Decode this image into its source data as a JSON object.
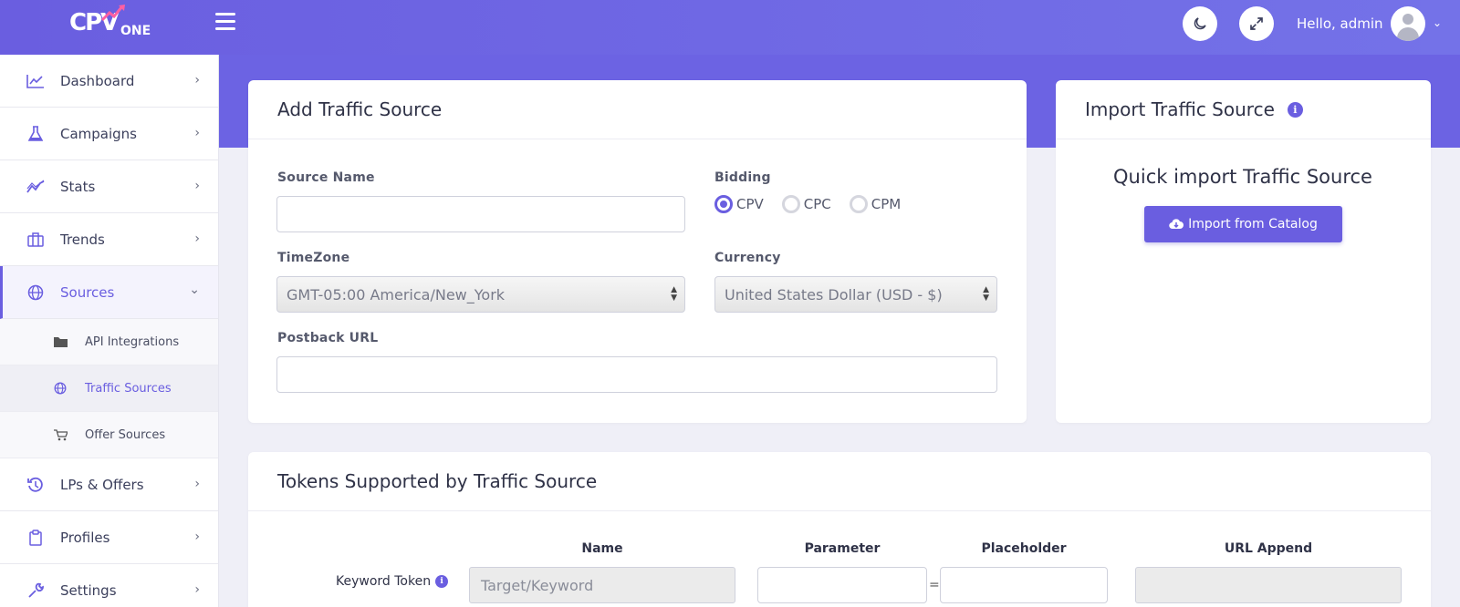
{
  "app": {
    "logo_text": "CPV",
    "logo_sub": "ONE",
    "greeting": "Hello, admin",
    "accent": "#6a5ee0"
  },
  "topbar_icons": [
    "hamburger-icon",
    "moon-icon",
    "expand-icon",
    "user-icon",
    "chevron-down-icon"
  ],
  "sidebar": {
    "items": [
      {
        "label": "Dashboard",
        "icon": "chart-line-icon"
      },
      {
        "label": "Campaigns",
        "icon": "flask-icon"
      },
      {
        "label": "Stats",
        "icon": "trend-icon"
      },
      {
        "label": "Trends",
        "icon": "briefcase-icon"
      },
      {
        "label": "Sources",
        "icon": "globe-icon",
        "expanded": true
      },
      {
        "label": "LPs & Offers",
        "icon": "history-icon"
      },
      {
        "label": "Profiles",
        "icon": "clipboard-icon"
      },
      {
        "label": "Settings",
        "icon": "wrench-icon"
      }
    ],
    "sources_sub": [
      {
        "label": "API Integrations",
        "icon": "folder-icon"
      },
      {
        "label": "Traffic Sources",
        "icon": "globe-icon",
        "active": true
      },
      {
        "label": "Offer Sources",
        "icon": "cart-icon"
      }
    ]
  },
  "add_source": {
    "title": "Add Traffic Source",
    "source_name_label": "Source Name",
    "source_name_value": "",
    "bidding_label": "Bidding",
    "bidding_options": [
      "CPV",
      "CPC",
      "CPM"
    ],
    "bidding_selected": "CPV",
    "timezone_label": "TimeZone",
    "timezone_value": "GMT-05:00 America/New_York",
    "currency_label": "Currency",
    "currency_value": "United States Dollar (USD - $)",
    "postback_label": "Postback URL",
    "postback_value": ""
  },
  "import_source": {
    "title": "Import Traffic Source",
    "subtitle": "Quick import Traffic Source",
    "button_label": "Import from Catalog"
  },
  "tokens": {
    "title": "Tokens Supported by Traffic Source",
    "columns": [
      "Name",
      "Parameter",
      "Placeholder",
      "URL Append"
    ],
    "rows": [
      {
        "label": "Keyword Token",
        "name_placeholder": "Target/Keyword",
        "parameter": "",
        "placeholder": "",
        "url_append": "",
        "separator": "="
      }
    ]
  }
}
